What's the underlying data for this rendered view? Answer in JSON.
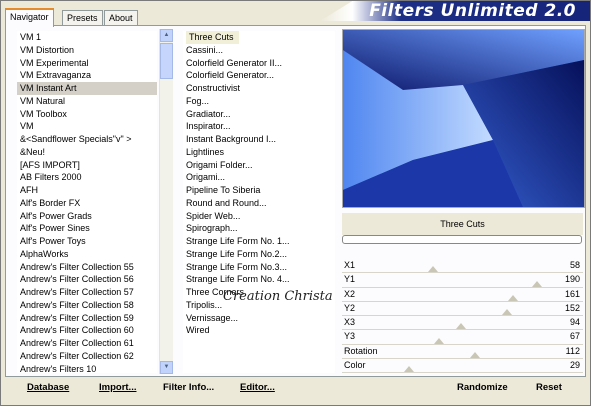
{
  "app": {
    "brand": "Filters Unlimited 2.0"
  },
  "tabs": [
    "Navigator",
    "Presets",
    "About"
  ],
  "categories": [
    "VM 1",
    "VM Distortion",
    "VM Experimental",
    "VM Extravaganza",
    "VM Instant Art",
    "VM Natural",
    "VM Toolbox",
    "VM",
    "&<Sandflower Specials\"v\" >",
    "&Neu!",
    "[AFS IMPORT]",
    "AB Filters 2000",
    "AFH",
    "Alf's Border FX",
    "Alf's Power Grads",
    "Alf's Power Sines",
    "Alf's Power Toys",
    "AlphaWorks",
    "Andrew's Filter Collection 55",
    "Andrew's Filter Collection 56",
    "Andrew's Filter Collection 57",
    "Andrew's Filter Collection 58",
    "Andrew's Filter Collection 59",
    "Andrew's Filter Collection 60",
    "Andrew's Filter Collection 61",
    "Andrew's Filter Collection 62",
    "Andrew's Filters 10"
  ],
  "selected_category": "VM Instant Art",
  "filters": [
    "Three Cuts",
    "Cassini...",
    "Colorfield Generator II...",
    "Colorfield Generator...",
    "Constructivist",
    "Fog...",
    "Gradiator...",
    "Inspirator...",
    "Instant Background I...",
    "Lightlines",
    "Origami Folder...",
    "Origami...",
    "Pipeline To Siberia",
    "Round and Round...",
    "Spider Web...",
    "Spirograph...",
    "Strange Life Form No. 1...",
    "Strange Life Form No.2...",
    "Strange Life Form No.3...",
    "Strange Life Form No. 4...",
    "Three Corners",
    "Tripolis...",
    "Vernissage...",
    "Wired"
  ],
  "selected_filter": "Three Cuts",
  "filter_name": "Three Cuts",
  "params": [
    {
      "label": "X1",
      "value": "58",
      "level": 0.23
    },
    {
      "label": "Y1",
      "value": "190",
      "level": 0.75
    },
    {
      "label": "X2",
      "value": "161",
      "level": 0.63
    },
    {
      "label": "Y2",
      "value": "152",
      "level": 0.6
    },
    {
      "label": "X3",
      "value": "94",
      "level": 0.37
    },
    {
      "label": "Y3",
      "value": "67",
      "level": 0.26
    },
    {
      "label": "Rotation",
      "value": "112",
      "level": 0.44
    },
    {
      "label": "Color",
      "value": "29",
      "level": 0.11
    }
  ],
  "watermark": "Creation Christa",
  "footer": {
    "database": "Database",
    "import": "Import...",
    "filter_info": "Filter Info...",
    "editor": "Editor...",
    "randomize": "Randomize",
    "reset": "Reset"
  },
  "colors": {
    "accent": "#e68b2c",
    "preview_dark": "#1b2a8a",
    "preview_light": "#9fc0ff"
  }
}
